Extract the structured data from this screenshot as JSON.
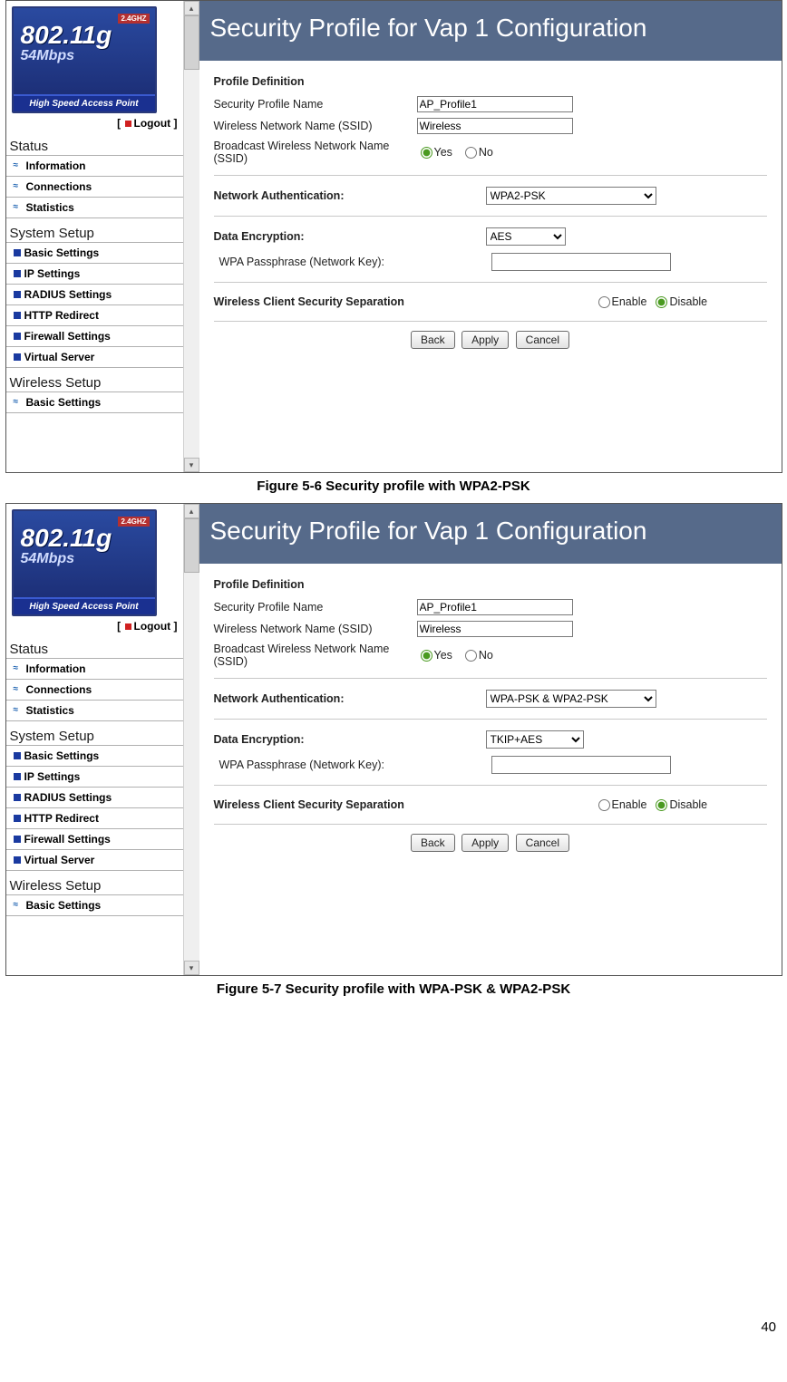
{
  "pageNumber": "40",
  "brand": {
    "ghz": "2.4GHZ",
    "spec": "802.11g",
    "rate": "54Mbps",
    "tagline": "High Speed Access Point"
  },
  "logout": "Logout",
  "nav": {
    "statusTitle": "Status",
    "status": [
      {
        "label": "Information",
        "bullet": "wave"
      },
      {
        "label": "Connections",
        "bullet": "wave"
      },
      {
        "label": "Statistics",
        "bullet": "wave"
      }
    ],
    "systemTitle": "System Setup",
    "system": [
      {
        "label": "Basic Settings",
        "bullet": "blue"
      },
      {
        "label": "IP Settings",
        "bullet": "blue"
      },
      {
        "label": "RADIUS Settings",
        "bullet": "blue"
      },
      {
        "label": "HTTP Redirect",
        "bullet": "blue"
      },
      {
        "label": "Firewall Settings",
        "bullet": "blue"
      },
      {
        "label": "Virtual Server",
        "bullet": "blue"
      }
    ],
    "wirelessTitle": "Wireless Setup",
    "wireless": [
      {
        "label": "Basic Settings",
        "bullet": "wave"
      }
    ]
  },
  "panel": {
    "title": "Security Profile for Vap 1 Configuration",
    "profileDefinition": "Profile Definition",
    "profileNameLabel": "Security Profile Name",
    "profileNameValue": "AP_Profile1",
    "ssidLabel": "Wireless Network Name (SSID)",
    "ssidValue": "Wireless",
    "broadcastLabel": "Broadcast Wireless Network Name (SSID)",
    "yes": "Yes",
    "no": "No",
    "authLabel": "Network Authentication:",
    "encLabel": "Data Encryption:",
    "passLabel": "WPA Passphrase (Network Key):",
    "sepLabel": "Wireless Client Security Separation",
    "enable": "Enable",
    "disable": "Disable",
    "back": "Back",
    "apply": "Apply",
    "cancel": "Cancel"
  },
  "fig1": {
    "caption": "Figure 5-6 Security profile with WPA2-PSK",
    "auth": "WPA2-PSK",
    "enc": "AES"
  },
  "fig2": {
    "caption": "Figure 5-7 Security profile with WPA-PSK & WPA2-PSK",
    "auth": "WPA-PSK & WPA2-PSK",
    "enc": "TKIP+AES"
  }
}
